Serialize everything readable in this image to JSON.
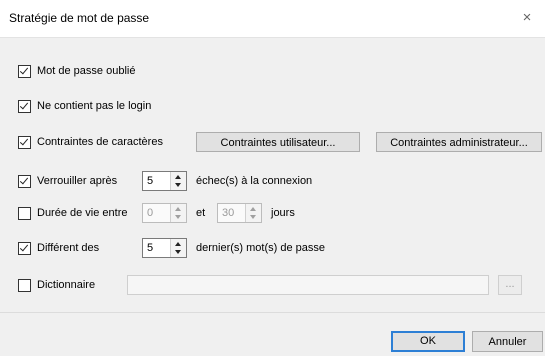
{
  "window": {
    "title": "Stratégie de mot de passe",
    "close_label": "×"
  },
  "options": {
    "forgot": {
      "label": "Mot de passe oublié",
      "checked": true
    },
    "no_login": {
      "label": "Ne contient pas le login",
      "checked": true
    },
    "char_constraints": {
      "label": "Contraintes de caractères",
      "checked": true
    },
    "lock_after": {
      "label": "Verrouiller après",
      "value": "5",
      "suffix": "échec(s) à la connexion",
      "checked": true
    },
    "lifetime": {
      "label": "Durée de vie entre",
      "min": "0",
      "and_label": "et",
      "max": "30",
      "suffix": "jours",
      "checked": false
    },
    "different": {
      "label": "Différent des",
      "value": "5",
      "suffix": "dernier(s) mot(s) de passe",
      "checked": true
    },
    "dictionary": {
      "label": "Dictionnaire",
      "path": "",
      "browse_label": "...",
      "checked": false
    }
  },
  "buttons": {
    "user_constraints": "Contraintes utilisateur...",
    "admin_constraints": "Contraintes administrateur...",
    "ok": "OK",
    "cancel": "Annuler"
  }
}
